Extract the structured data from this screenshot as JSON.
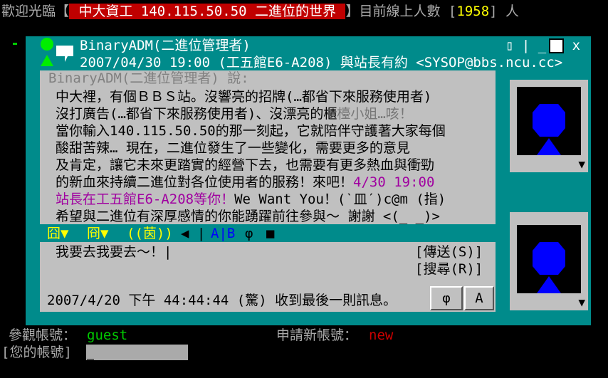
{
  "banner": {
    "welcome": "歡迎光臨【",
    "site": " 中大資工  140.115.50.50 二進位的世界 ",
    "online_label": "】目前線上人數 [",
    "online_count": "1958",
    "online_tail": "] 人"
  },
  "window": {
    "sender": "BinaryADM(二進位管理者)",
    "date_line": "2007/04/30 19:00 (工五館E6-A208) 與站長有約 <SYSOP@bbs.ncu.cc>",
    "controls": "▯ | _"
  },
  "message": {
    "head": "BinaryADM(二進位管理者) 說:",
    "lines": [
      "中大裡，有個ＢＢＳ站。沒響亮的招牌(…都省下來服務使用者)",
      "沒打廣告(…都省下來服務使用者)、沒漂亮的櫃",
      "當你輸入140.115.50.50的那一刻起，它就陪伴守護著大家每個",
      "酸甜苦辣…   現在，二進位發生了一些變化，需要更多的意見",
      "及肯定，讓它未來更踏實的經營下去，也需要有更多熱血與衝勁",
      "的新血來持續二進位對各位使用者的服務！來吧！",
      "站長在工五館E6-A208等你！",
      "希望與二進位有深厚感情的你能踴躍前往參與～ 謝謝 <(_ _)>"
    ],
    "line2_faded": "檯小姐…咳！",
    "line6_date": "4/30 19:00",
    "line7_tail": "We Want You！(ˋ皿ˊ)c@m (指)"
  },
  "toolbar": {
    "item1": "囧▼",
    "item2": "冏▼",
    "item3": "((茵))",
    "item4": "◀ |",
    "item5": "A|B",
    "item6": "φ",
    "item7": "■"
  },
  "reply": {
    "text": "我要去我要去～！|",
    "send_label": "[傳送(S)]",
    "search_label": "[搜尋(R)]"
  },
  "status": {
    "text": "2007/4/20  下午 44:44:44 (驚) 收到最後一則訊息。",
    "phi_label": "φ",
    "a_label": "A"
  },
  "login": {
    "guest_label": "參觀帳號：",
    "guest_value": "guest",
    "new_label": "申請新帳號：",
    "new_value": "new",
    "account_label": "[您的帳號]"
  },
  "colors": {
    "teal": "#008b8b",
    "panel": "#c0c0c0",
    "banner_bg": "#c00000",
    "guest": "#00cc00",
    "new": "#cc0000",
    "avatar_blue": "#0000ff"
  }
}
